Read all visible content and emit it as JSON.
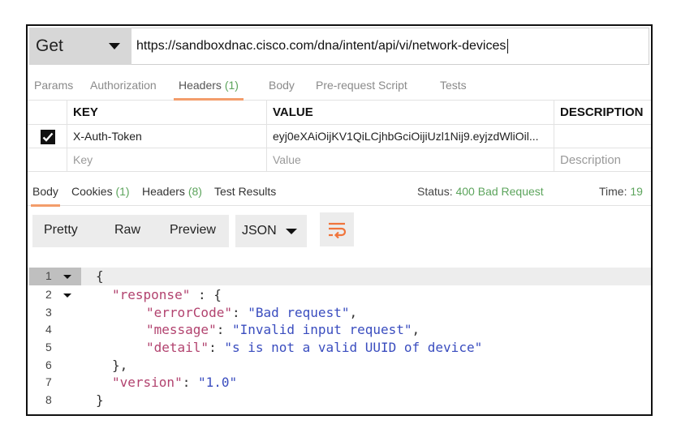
{
  "request": {
    "method": "Get",
    "url": "https://sandboxdnac.cisco.com/dna/intent/api/vi/network-devices"
  },
  "request_tabs": {
    "params": "Params",
    "authorization": "Authorization",
    "headers": "Headers",
    "headers_count": "(1)",
    "body": "Body",
    "prerequest": "Pre-request Script",
    "tests": "Tests"
  },
  "headers_table": {
    "columns": {
      "key": "KEY",
      "value": "VALUE",
      "description": "DESCRIPTION"
    },
    "row": {
      "key": "X-Auth-Token",
      "value": "eyj0eXAiOijKV1QiLCjhbGciOijiUzl1Nij9.eyjzdWliOil...",
      "description": ""
    },
    "placeholders": {
      "key": "Key",
      "value": "Value",
      "description": "Description"
    }
  },
  "response_tabs": {
    "body": "Body",
    "cookies": "Cookies",
    "cookies_count": "(1)",
    "headers": "Headers",
    "headers_count": "(8)",
    "test_results": "Test Results"
  },
  "status": {
    "label": "Status:",
    "code": "400",
    "text": "Bad Request",
    "time_label": "Time:",
    "time_value": "19"
  },
  "view": {
    "pretty": "Pretty",
    "raw": "Raw",
    "preview": "Preview",
    "format": "JSON"
  },
  "code": {
    "line_numbers": [
      "1",
      "2",
      "3",
      "4",
      "5",
      "6",
      "7",
      "8"
    ],
    "open_brace": "{",
    "response_key": "\"response\"",
    "response_sep": " : {",
    "errorcode_key": "\"errorCode\"",
    "errorcode_val": "\"Bad request\"",
    "message_key": "\"message\"",
    "message_val": "\"Invalid input request\"",
    "detail_key": "\"detail\"",
    "detail_val": "\"s is not a valid UUID of device\"",
    "close_inner": "},",
    "version_key": "\"version\"",
    "version_val": "\"1.0\"",
    "close_brace": "}"
  },
  "colors": {
    "accent_underline": "#f39d6b",
    "count_green": "#5ca45c",
    "json_key": "#b2436f",
    "json_string": "#3a4dbf"
  }
}
